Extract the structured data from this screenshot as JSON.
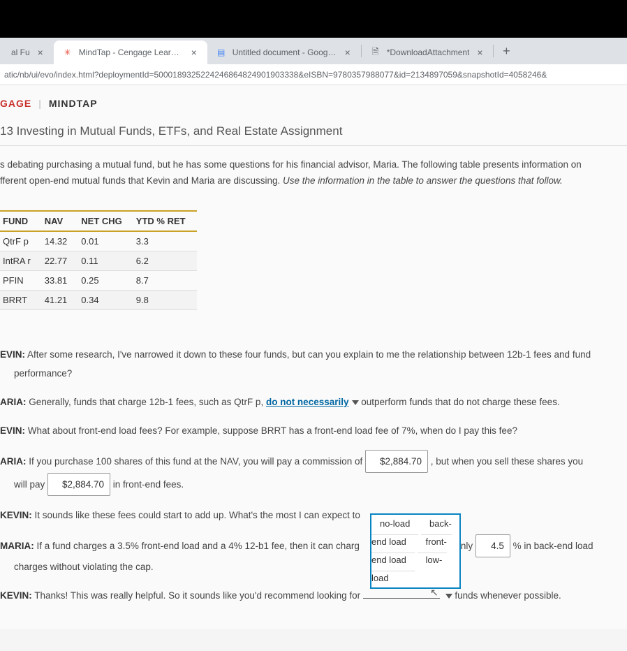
{
  "tabs": [
    {
      "title": "al Fu",
      "favicon": ""
    },
    {
      "title": "MindTap - Cengage Learning",
      "favicon": "✳"
    },
    {
      "title": "Untitled document - Google Docs",
      "favicon": "≡"
    },
    {
      "title": "*DownloadAttachment",
      "favicon": "▭"
    }
  ],
  "addr_url": "atic/nb/ui/evo/index.html?deploymentId=5000189325224246864824901903338&eISBN=9780357988077&id=2134897059&snapshotId=4058246&",
  "brand": {
    "a": "GAGE",
    "b": "MINDTAP"
  },
  "chapter_title": "13 Investing in Mutual Funds, ETFs, and Real Estate Assignment",
  "intro_a": "s debating purchasing a mutual fund, but he has some questions for his financial advisor, Maria. The following table presents information on",
  "intro_b_plain": "fferent open-end mutual funds that Kevin and Maria are discussing. ",
  "intro_b_italic": "Use the information in the table to answer the questions that follow.",
  "table": {
    "headers": [
      "FUND",
      "NAV",
      "NET CHG",
      "YTD % RET"
    ],
    "rows": [
      [
        "QtrF p",
        "14.32",
        "0.01",
        "3.3"
      ],
      [
        "IntRA r",
        "22.77",
        "0.11",
        "6.2"
      ],
      [
        "PFIN",
        "33.81",
        "0.25",
        "8.7"
      ],
      [
        "BRRT",
        "41.21",
        "0.34",
        "9.8"
      ]
    ]
  },
  "d": {
    "kevin1_a": "After some research, I've narrowed it down to these four funds, but can you explain to me the relationship between 12b-1 fees and fund",
    "kevin1_b": "performance?",
    "maria1_a": "Generally, funds that charge 12b-1 fees, such as QtrF p, ",
    "maria1_link": "do not necessarily",
    "maria1_b": " outperform funds that do not charge these fees.",
    "kevin2": "What about front-end load fees? For example, suppose BRRT has a front-end load fee of 7%, when do I pay this fee?",
    "maria2_a": "If you purchase 100 shares of this fund at the NAV, you will pay a commission of ",
    "maria2_val1": "$2,884.70",
    "maria2_b": " , but when you sell these shares you",
    "maria2_c": "will pay ",
    "maria2_val2": "$2,884.70",
    "maria2_d": " in front-end fees.",
    "kevin3": "It sounds like these fees could start to add up. What's the most I can expect to",
    "maria3_a": "If a fund charges a 3.5% front-end load and a 4% 12-b1 fee, then it can charg",
    "maria3_b": " only ",
    "maria3_val": "4.5",
    "maria3_c": " % in back-end load",
    "maria3_d": "charges without violating the cap.",
    "kevin4_a": "Thanks! This was really helpful. So it sounds like you'd recommend looking for ",
    "kevin4_b": " funds whenever possible."
  },
  "dropdown": {
    "opts": [
      "no-load",
      "back-end load",
      "front-end load",
      "low-load"
    ]
  },
  "labels": {
    "kevin": "EVIN:",
    "maria": "ARIA:",
    "maria_h": "MARIA:",
    "kevin_k": "KEVIN:"
  }
}
